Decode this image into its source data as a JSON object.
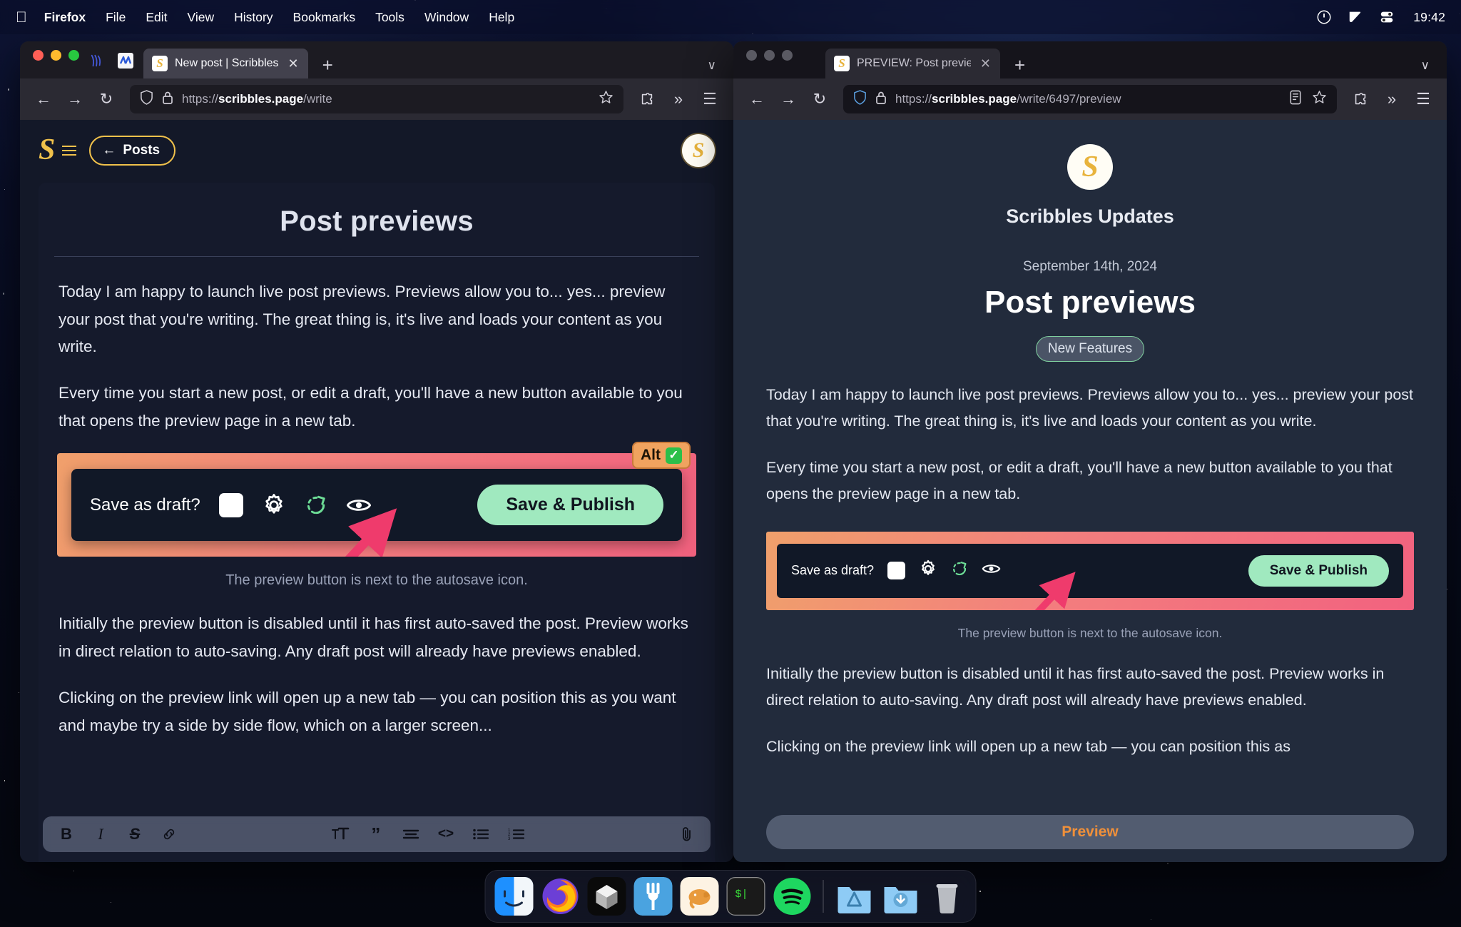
{
  "menubar": {
    "apple_icon": "apple-icon",
    "items": [
      {
        "label": "Firefox",
        "bold": true
      },
      {
        "label": "File",
        "bold": false
      },
      {
        "label": "Edit",
        "bold": false
      },
      {
        "label": "View",
        "bold": false
      },
      {
        "label": "History",
        "bold": false
      },
      {
        "label": "Bookmarks",
        "bold": false
      },
      {
        "label": "Tools",
        "bold": false
      },
      {
        "label": "Window",
        "bold": false
      },
      {
        "label": "Help",
        "bold": false
      }
    ],
    "status_icons": [
      "do-not-disturb-icon",
      "display-icon",
      "control-center-icon"
    ],
    "clock": "19:42"
  },
  "left_window": {
    "tab": {
      "title": "New post | Scribbles",
      "favicon": "scribbles-favicon",
      "close": "✕",
      "new_tab": "+",
      "list_all_tabs": "∨"
    },
    "toolbar_icons": [
      "pocket-icon",
      "extension-icon"
    ],
    "nav": {
      "back": "←",
      "forward": "→",
      "reload": "↻",
      "shield": "shield-icon",
      "lock": "lock-icon",
      "url_prefix": "https://",
      "url_host": "scribbles.page",
      "url_path": "/write",
      "bookmark": "star-icon",
      "extensions": "puzzle-icon",
      "overflow": "»",
      "menu": "☰"
    },
    "editor": {
      "logo": "S",
      "hamburger": "hamburger-icon",
      "posts_button": "Posts",
      "posts_arrow": "←",
      "avatar": "S",
      "doc_title": "Post previews",
      "paragraph_1": "Today I am happy to launch live post previews. Previews allow you to... yes... preview your post that you're writing. The great thing is, it's live and loads your content as you write.",
      "paragraph_2": "Every time you start a new post, or edit a draft, you'll have a new button available to you that opens the preview page in a new tab.",
      "embedded_image": {
        "alt_badge_label": "Alt",
        "alt_badge_check": "✓",
        "save_as_draft_label": "Save as draft?",
        "checkbox": "unchecked-checkbox",
        "settings_icon": "gear-icon",
        "autosave_icon": "autosave-spinner-icon",
        "preview_icon": "eye-icon",
        "arrow": "pink-arrow-annotation",
        "publish_button": "Save & Publish"
      },
      "caption": "The preview button is next to the autosave icon.",
      "paragraph_3": "Initially the preview button is disabled until it has first auto-saved the post. Preview works in direct relation to auto-saving. Any draft post will already have previews enabled.",
      "paragraph_4_clipped": "Clicking on the preview link will open up a new tab — you can position this as you want and maybe try a side by side flow, which on a larger screen...",
      "format_toolbar": [
        {
          "name": "bold-icon",
          "glyph": "B"
        },
        {
          "name": "italic-icon",
          "glyph": "I"
        },
        {
          "name": "strikethrough-icon",
          "glyph": "S"
        },
        {
          "name": "link-icon",
          "glyph": "ὑ7"
        },
        {
          "name": "text-size-icon",
          "glyph": "T"
        },
        {
          "name": "blockquote-icon",
          "glyph": "”"
        },
        {
          "name": "align-icon",
          "glyph": "☰"
        },
        {
          "name": "code-icon",
          "glyph": "<>"
        },
        {
          "name": "bullet-list-icon",
          "glyph": "☰"
        },
        {
          "name": "numbered-list-icon",
          "glyph": "☰"
        },
        {
          "name": "attachment-icon",
          "glyph": "Ὄe"
        }
      ]
    }
  },
  "right_window": {
    "tab": {
      "title": "PREVIEW: Post previews | Scribb",
      "favicon": "scribbles-favicon",
      "close": "✕",
      "new_tab": "+",
      "list_all_tabs": "∨"
    },
    "nav": {
      "back": "←",
      "forward": "→",
      "reload": "↻",
      "shield": "shield-icon",
      "lock": "lock-icon",
      "url_prefix": "https://",
      "url_host": "scribbles.page",
      "url_path": "/write/6497/preview",
      "reader": "reader-view-icon",
      "bookmark": "star-icon",
      "extensions": "puzzle-icon",
      "overflow": "»",
      "menu": "☰"
    },
    "preview": {
      "logo": "S",
      "site_name": "Scribbles Updates",
      "date": "September 14th, 2024",
      "post_title": "Post previews",
      "tag": "New Features",
      "paragraph_1": "Today I am happy to launch live post previews. Previews allow you to... yes... preview your post that you're writing. The great thing is, it's live and loads your content as you write.",
      "paragraph_2": "Every time you start a new post, or edit a draft, you'll have a new button available to you that opens the preview page in a new tab.",
      "embedded_image": {
        "save_as_draft_label": "Save as draft?",
        "checkbox": "unchecked-checkbox",
        "settings_icon": "gear-icon",
        "autosave_icon": "autosave-spinner-icon",
        "preview_icon": "eye-icon",
        "arrow": "pink-arrow-annotation",
        "publish_button": "Save & Publish"
      },
      "caption": "The preview button is next to the autosave icon.",
      "paragraph_3": "Initially the preview button is disabled until it has first auto-saved the post. Preview works in direct relation to auto-saving. Any draft post will already have previews enabled.",
      "paragraph_4_clipped": "Clicking on the preview link will open up a new tab — you can position this as",
      "preview_button": "Preview"
    }
  },
  "dock": {
    "items": [
      {
        "name": "finder",
        "label": "Finder"
      },
      {
        "name": "firefox",
        "label": "Firefox"
      },
      {
        "name": "cube-app",
        "label": "Cube"
      },
      {
        "name": "fork",
        "label": "Fork"
      },
      {
        "name": "elephant-app",
        "label": "Postgres"
      },
      {
        "name": "terminal",
        "label": "Terminal"
      },
      {
        "name": "spotify",
        "label": "Spotify"
      },
      {
        "name": "applications-folder",
        "label": "Applications"
      },
      {
        "name": "downloads-folder",
        "label": "Downloads"
      },
      {
        "name": "trash",
        "label": "Trash"
      }
    ]
  },
  "colors": {
    "brand_yellow": "#f0c14b",
    "publish_green": "#a0e9bf",
    "arrow_pink": "#ef3b6c",
    "alt_orange": "#f0a35f",
    "preview_orange": "#f0903a",
    "tag_green": "#7fcf9e"
  }
}
